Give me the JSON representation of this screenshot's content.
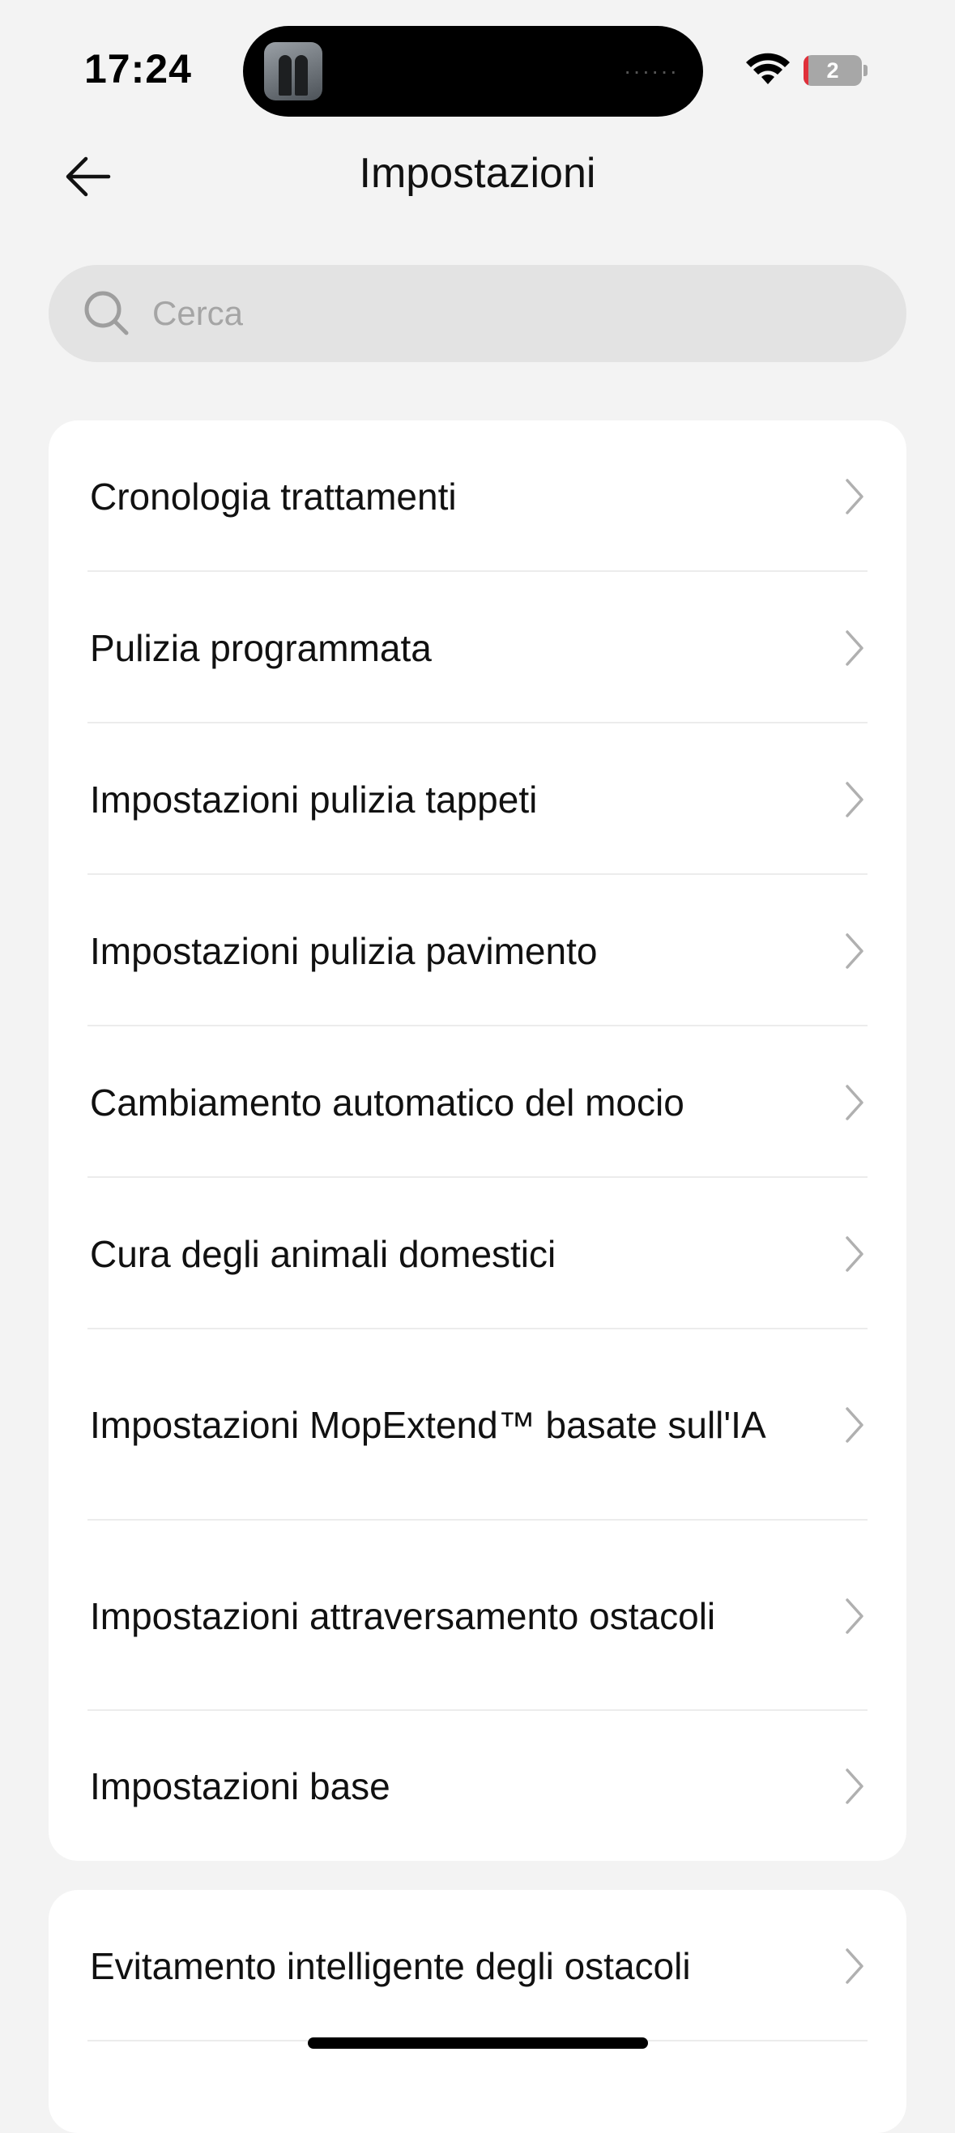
{
  "status_bar": {
    "time": "17:24",
    "battery_level": "2",
    "icons": [
      "wifi-icon",
      "battery-icon"
    ]
  },
  "header": {
    "title": "Impostazioni",
    "back_icon": "arrow-left-icon"
  },
  "search": {
    "placeholder": "Cerca",
    "value": ""
  },
  "settings_group_1": {
    "items": [
      {
        "label": "Cronologia trattamenti"
      },
      {
        "label": "Pulizia programmata"
      },
      {
        "label": "Impostazioni pulizia tappeti"
      },
      {
        "label": "Impostazioni pulizia pavimento"
      },
      {
        "label": "Cambiamento automatico del mocio"
      },
      {
        "label": "Cura degli animali domestici"
      },
      {
        "label": "Impostazioni MopExtend™ basate sull'IA"
      },
      {
        "label": "Impostazioni attraversamento ostacoli"
      },
      {
        "label": "Impostazioni base"
      }
    ]
  },
  "settings_group_2": {
    "items": [
      {
        "label": "Evitamento intelligente degli ostacoli"
      }
    ]
  },
  "colors": {
    "background": "#f3f3f3",
    "card": "#ffffff",
    "search_bg": "#e3e3e3",
    "chevron": "#b0b0b0",
    "battery_low": "#e0303a"
  }
}
